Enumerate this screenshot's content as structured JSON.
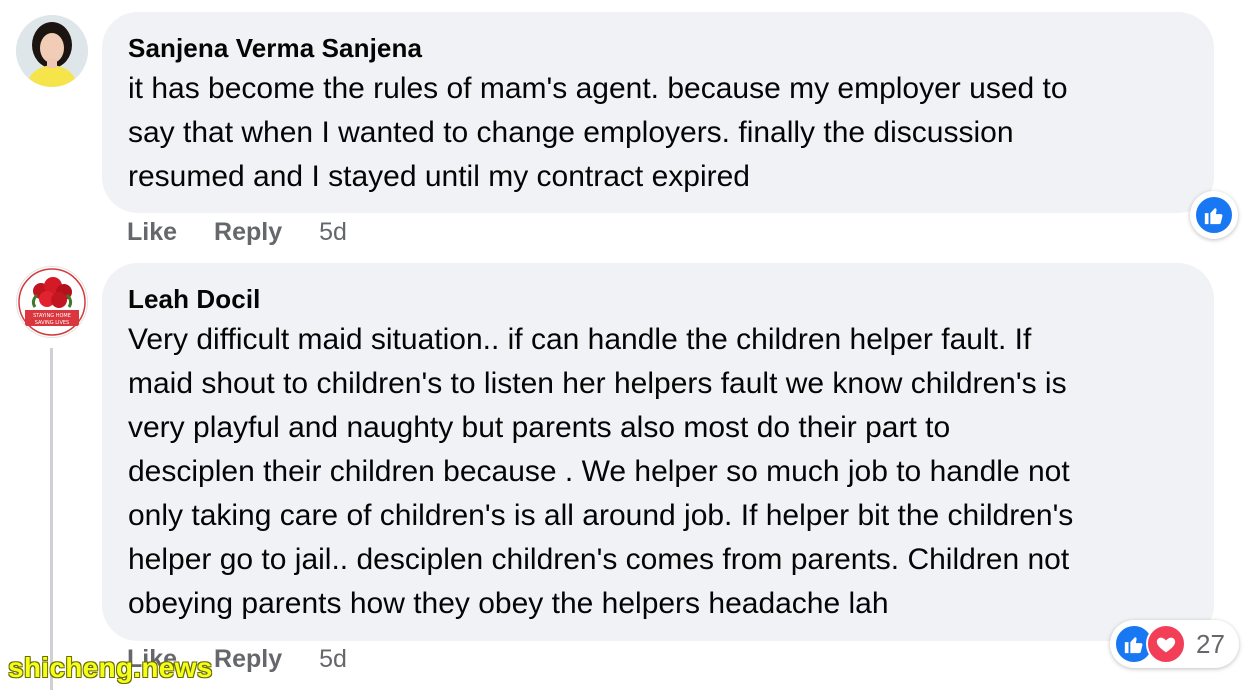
{
  "comments": [
    {
      "author": "Sanjena Verma Sanjena",
      "text": "it has become the rules of mam's agent. because my employer used to\nsay that when I wanted to change employers. finally the discussion\nresumed and I stayed until my contract expired",
      "actions": {
        "like": "Like",
        "reply": "Reply",
        "time": "5d"
      },
      "reactions": {
        "icons": [
          "like-icon"
        ]
      }
    },
    {
      "author": "Leah Docil",
      "avatar_caption": "STAYING HOME SAVING LIVES",
      "text": "Very difficult maid situation.. if can handle the children helper fault. If\nmaid shout to children's to listen her helpers fault we know children's is\nvery playful and naughty but parents also most do their part to\ndesciplen their children because . We helper so much job to handle not\nonly taking care of children's is all around job. If helper bit the children's\nhelper go to jail.. desciplen children's comes from parents. Children not\nobeying parents how they obey the helpers headache lah",
      "actions": {
        "like": "Like",
        "reply": "Reply",
        "time": "5d"
      },
      "reactions": {
        "icons": [
          "like-icon",
          "love-icon"
        ],
        "count": "27"
      }
    }
  ],
  "watermark": "shicheng.news",
  "colors": {
    "bubble": "#f0f2f5",
    "like": "#1877f2",
    "love": "#f33e58",
    "meta": "#65676b"
  }
}
